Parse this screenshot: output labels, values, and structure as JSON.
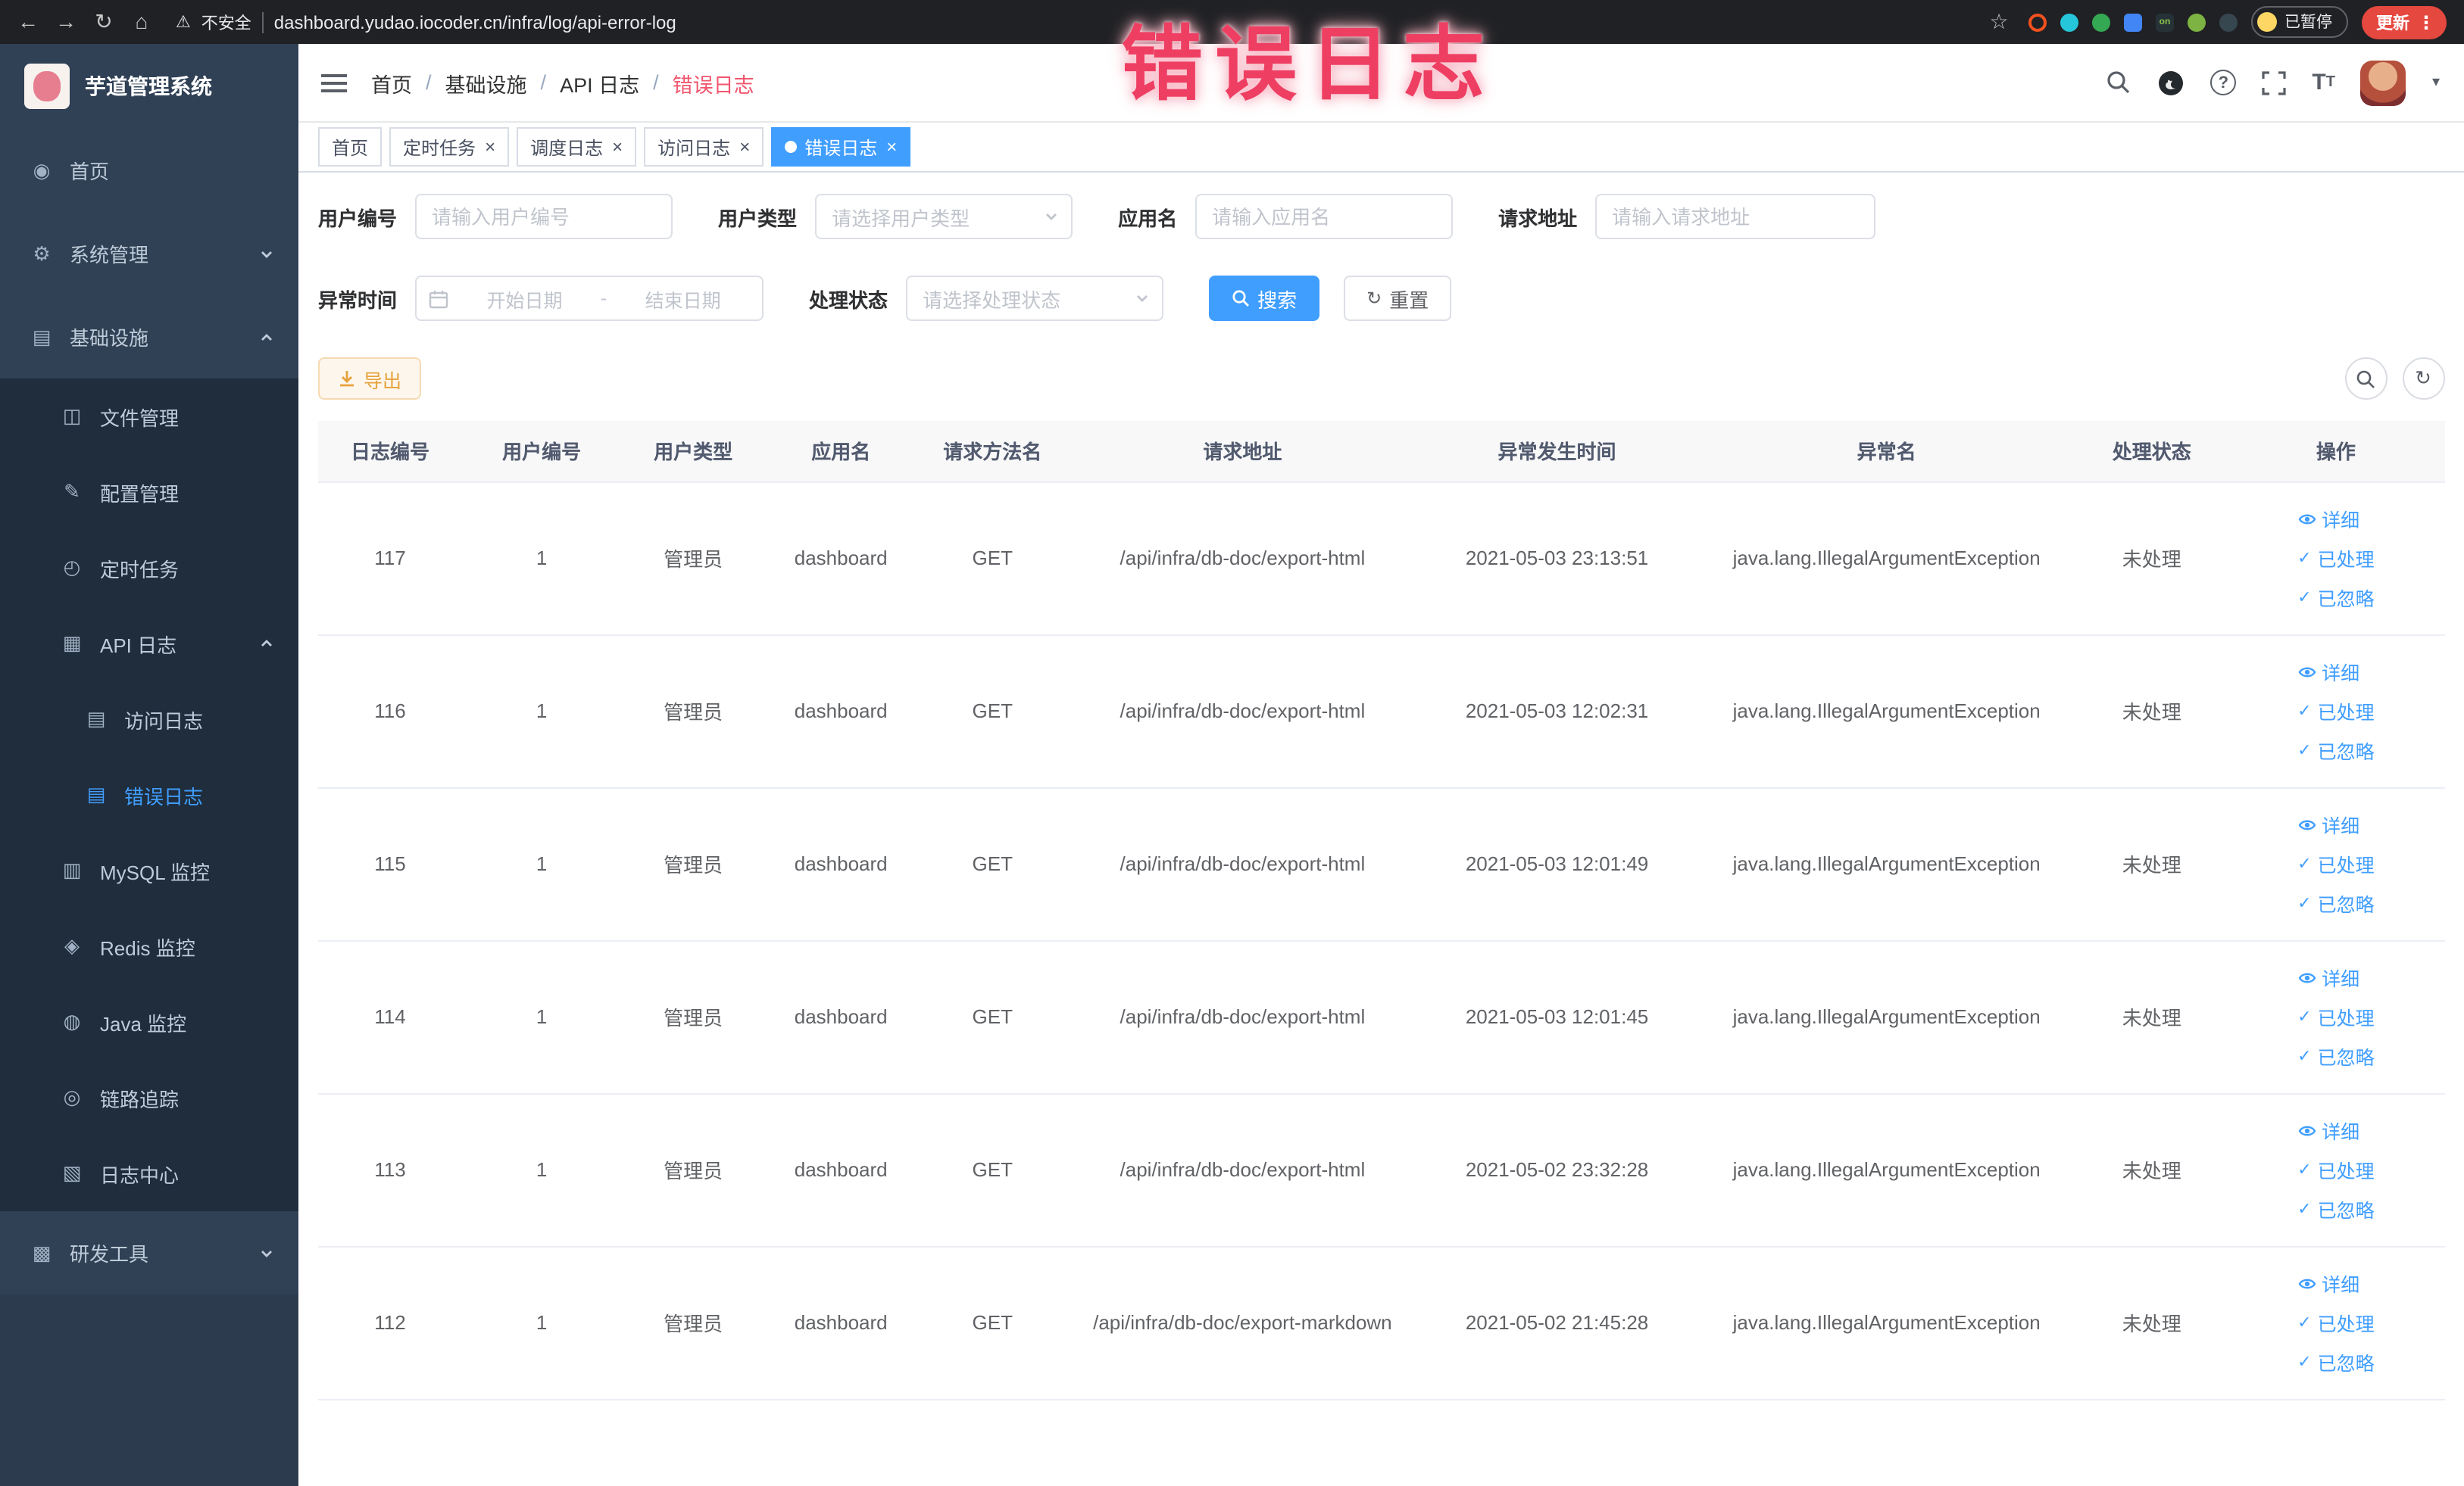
{
  "browser": {
    "security_warning": "不安全",
    "url": "dashboard.yudao.iocoder.cn/infra/log/api-error-log",
    "paused_badge": "已暂停",
    "update_button": "更新"
  },
  "overlay": {
    "annotation": "错误日志"
  },
  "sidebar": {
    "app_title": "芋道管理系统",
    "items": [
      {
        "label": "首页",
        "level": 1,
        "icon": "home"
      },
      {
        "label": "系统管理",
        "level": 1,
        "icon": "gear",
        "expanded": false
      },
      {
        "label": "基础设施",
        "level": 1,
        "icon": "infrastructure",
        "expanded": true
      },
      {
        "label": "文件管理",
        "level": 2,
        "icon": "file"
      },
      {
        "label": "配置管理",
        "level": 2,
        "icon": "config"
      },
      {
        "label": "定时任务",
        "level": 2,
        "icon": "timer"
      },
      {
        "label": "API 日志",
        "level": 2,
        "icon": "api-log",
        "expanded": true
      },
      {
        "label": "访问日志",
        "level": 3,
        "icon": "access-log"
      },
      {
        "label": "错误日志",
        "level": 3,
        "icon": "error-log",
        "active": true
      },
      {
        "label": "MySQL 监控",
        "level": 2,
        "icon": "mysql"
      },
      {
        "label": "Redis 监控",
        "level": 2,
        "icon": "redis"
      },
      {
        "label": "Java 监控",
        "level": 2,
        "icon": "java"
      },
      {
        "label": "链路追踪",
        "level": 2,
        "icon": "trace"
      },
      {
        "label": "日志中心",
        "level": 2,
        "icon": "log-center"
      },
      {
        "label": "研发工具",
        "level": 1,
        "icon": "devtools",
        "expanded": false
      }
    ]
  },
  "header": {
    "breadcrumb": [
      "首页",
      "基础设施",
      "API 日志",
      "错误日志"
    ],
    "separator": "/"
  },
  "tabs": [
    {
      "label": "首页",
      "closable": false,
      "active": false
    },
    {
      "label": "定时任务",
      "closable": true,
      "active": false
    },
    {
      "label": "调度日志",
      "closable": true,
      "active": false
    },
    {
      "label": "访问日志",
      "closable": true,
      "active": false
    },
    {
      "label": "错误日志",
      "closable": true,
      "active": true
    }
  ],
  "filters": {
    "user_id": {
      "label": "用户编号",
      "placeholder": "请输入用户编号"
    },
    "user_type": {
      "label": "用户类型",
      "placeholder": "请选择用户类型"
    },
    "app_name": {
      "label": "应用名",
      "placeholder": "请输入应用名"
    },
    "request_url": {
      "label": "请求地址",
      "placeholder": "请输入请求地址"
    },
    "exception_time": {
      "label": "异常时间",
      "start_placeholder": "开始日期",
      "separator": "-",
      "end_placeholder": "结束日期"
    },
    "process_status": {
      "label": "处理状态",
      "placeholder": "请选择处理状态"
    },
    "search_button": "搜索",
    "reset_button": "重置"
  },
  "toolbar": {
    "export_button": "导出"
  },
  "table": {
    "columns": [
      "日志编号",
      "用户编号",
      "用户类型",
      "应用名",
      "请求方法名",
      "请求地址",
      "异常发生时间",
      "异常名",
      "处理状态",
      "操作"
    ],
    "actions": [
      "详细",
      "已处理",
      "已忽略"
    ],
    "rows": [
      {
        "id": "117",
        "user_id": "1",
        "user_type": "管理员",
        "app": "dashboard",
        "method": "GET",
        "url": "/api/infra/db-doc/export-html",
        "time": "2021-05-03 23:13:51",
        "exception": "java.lang.IllegalArgumentException",
        "status": "未处理"
      },
      {
        "id": "116",
        "user_id": "1",
        "user_type": "管理员",
        "app": "dashboard",
        "method": "GET",
        "url": "/api/infra/db-doc/export-html",
        "time": "2021-05-03 12:02:31",
        "exception": "java.lang.IllegalArgumentException",
        "status": "未处理"
      },
      {
        "id": "115",
        "user_id": "1",
        "user_type": "管理员",
        "app": "dashboard",
        "method": "GET",
        "url": "/api/infra/db-doc/export-html",
        "time": "2021-05-03 12:01:49",
        "exception": "java.lang.IllegalArgumentException",
        "status": "未处理"
      },
      {
        "id": "114",
        "user_id": "1",
        "user_type": "管理员",
        "app": "dashboard",
        "method": "GET",
        "url": "/api/infra/db-doc/export-html",
        "time": "2021-05-03 12:01:45",
        "exception": "java.lang.IllegalArgumentException",
        "status": "未处理"
      },
      {
        "id": "113",
        "user_id": "1",
        "user_type": "管理员",
        "app": "dashboard",
        "method": "GET",
        "url": "/api/infra/db-doc/export-html",
        "time": "2021-05-02 23:32:28",
        "exception": "java.lang.IllegalArgumentException",
        "status": "未处理"
      },
      {
        "id": "112",
        "user_id": "1",
        "user_type": "管理员",
        "app": "dashboard",
        "method": "GET",
        "url": "/api/infra/db-doc/export-markdown",
        "time": "2021-05-02 21:45:28",
        "exception": "java.lang.IllegalArgumentException",
        "status": "未处理"
      }
    ]
  },
  "colors": {
    "accent": "#409eff",
    "warning": "#e6a23c",
    "sidebar_bg": "#304156",
    "submenu_bg": "#1f2d3d",
    "annotation_pink": "#ee3f63"
  }
}
